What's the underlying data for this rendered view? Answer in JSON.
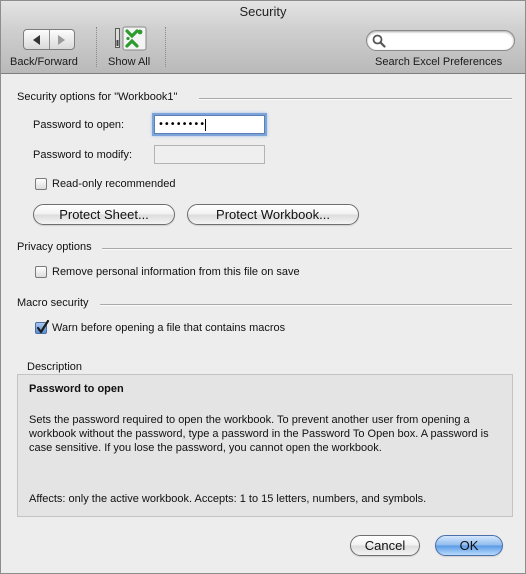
{
  "window": {
    "title": "Security"
  },
  "toolbar": {
    "back_forward_label": "Back/Forward",
    "show_all_label": "Show All",
    "search_placeholder": "",
    "search_label": "Search Excel Preferences"
  },
  "security": {
    "heading": "Security options for \"Workbook1\"",
    "password_open_label": "Password to open:",
    "password_open_value": "••••••••",
    "password_modify_label": "Password to modify:",
    "password_modify_value": "",
    "readonly_label": "Read-only recommended",
    "readonly_checked": false,
    "protect_sheet_label": "Protect Sheet...",
    "protect_workbook_label": "Protect Workbook..."
  },
  "privacy": {
    "heading": "Privacy options",
    "remove_info_label": "Remove personal information from this file on save",
    "remove_info_checked": false
  },
  "macro": {
    "heading": "Macro security",
    "warn_label": "Warn before opening a file that contains macros",
    "warn_checked": true
  },
  "description": {
    "heading": "Description",
    "title": "Password to open",
    "body": "Sets the password required to open the workbook. To prevent another user from opening a workbook without the password, type a password in the Password To Open box. A password is case sensitive. If you lose the password, you cannot open the workbook.",
    "affects": "Affects: only the active workbook. Accepts: 1 to 15 letters, numbers, and symbols."
  },
  "buttons": {
    "cancel_label": "Cancel",
    "ok_label": "OK"
  },
  "colors": {
    "accent": "#5a9be7",
    "check": "#4c6fa3"
  }
}
